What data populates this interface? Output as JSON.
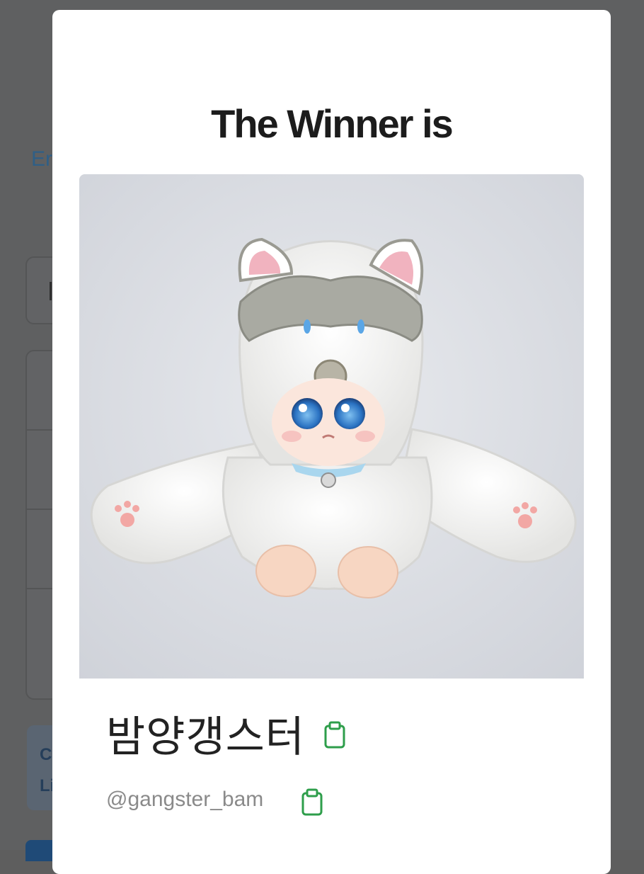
{
  "background": {
    "link_fragment": "Er",
    "banner_lines": [
      "C",
      "Li"
    ]
  },
  "modal": {
    "title": "The Winner is",
    "winner": {
      "name": "밤양갱스터",
      "handle": "@gangster_bam",
      "copy_icon": "clipboard-icon"
    }
  },
  "colors": {
    "accent_green": "#2e9e4b",
    "title_text": "#1c1c1c",
    "handle_text": "#8a8a8a"
  }
}
